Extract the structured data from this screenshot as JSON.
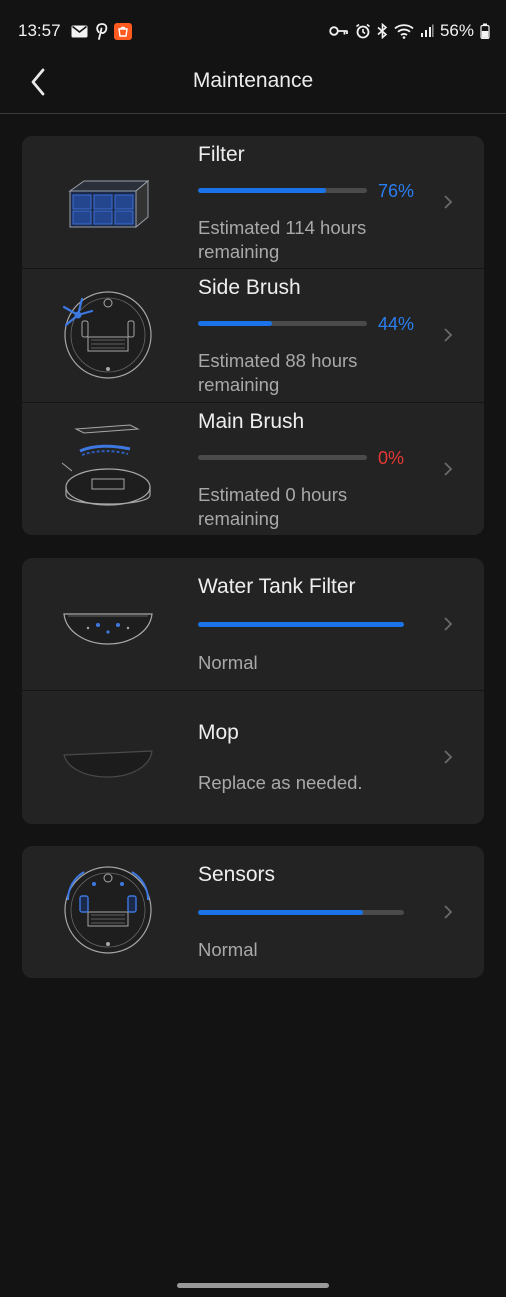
{
  "status_bar": {
    "time": "13:57",
    "left_icons": [
      "mail-icon",
      "pinterest-icon",
      "shopping-app-icon"
    ],
    "right_icons": [
      "vpn-key-icon",
      "alarm-icon",
      "bluetooth-icon",
      "wifi-icon",
      "signal-icon"
    ],
    "battery": "56%",
    "battery_level": 0.56,
    "shop_color": "#ff5a1f"
  },
  "app_bar": {
    "title": "Maintenance",
    "back_icon": "chevron-left-icon"
  },
  "colors": {
    "background": "#131313",
    "card": "#232323",
    "accent_blue": "#1a73e8",
    "percent_blue": "#2a7ef0",
    "percent_red": "#e53935"
  },
  "groups": [
    {
      "items": [
        {
          "title": "Filter",
          "progress": 0.76,
          "percent": "76%",
          "subtitle": "Estimated 114 hours remaining",
          "icon": "filter-image"
        },
        {
          "title": "Side Brush",
          "progress": 0.44,
          "percent": "44%",
          "subtitle": "Estimated 88 hours remaining",
          "icon": "side-brush-image"
        },
        {
          "title": "Main Brush",
          "progress": 0.0,
          "percent": "0%",
          "subtitle": "Estimated 0 hours remaining",
          "icon": "main-brush-image"
        }
      ]
    },
    {
      "items": [
        {
          "title": "Water Tank Filter",
          "progress": 1.0,
          "subtitle": "Normal",
          "icon": "water-tank-filter-image"
        },
        {
          "title": "Mop",
          "subtitle": "Replace as needed.",
          "icon": "mop-image"
        }
      ]
    },
    {
      "items": [
        {
          "title": "Sensors",
          "progress": 0.8,
          "subtitle": "Normal",
          "icon": "sensors-image"
        }
      ]
    }
  ]
}
